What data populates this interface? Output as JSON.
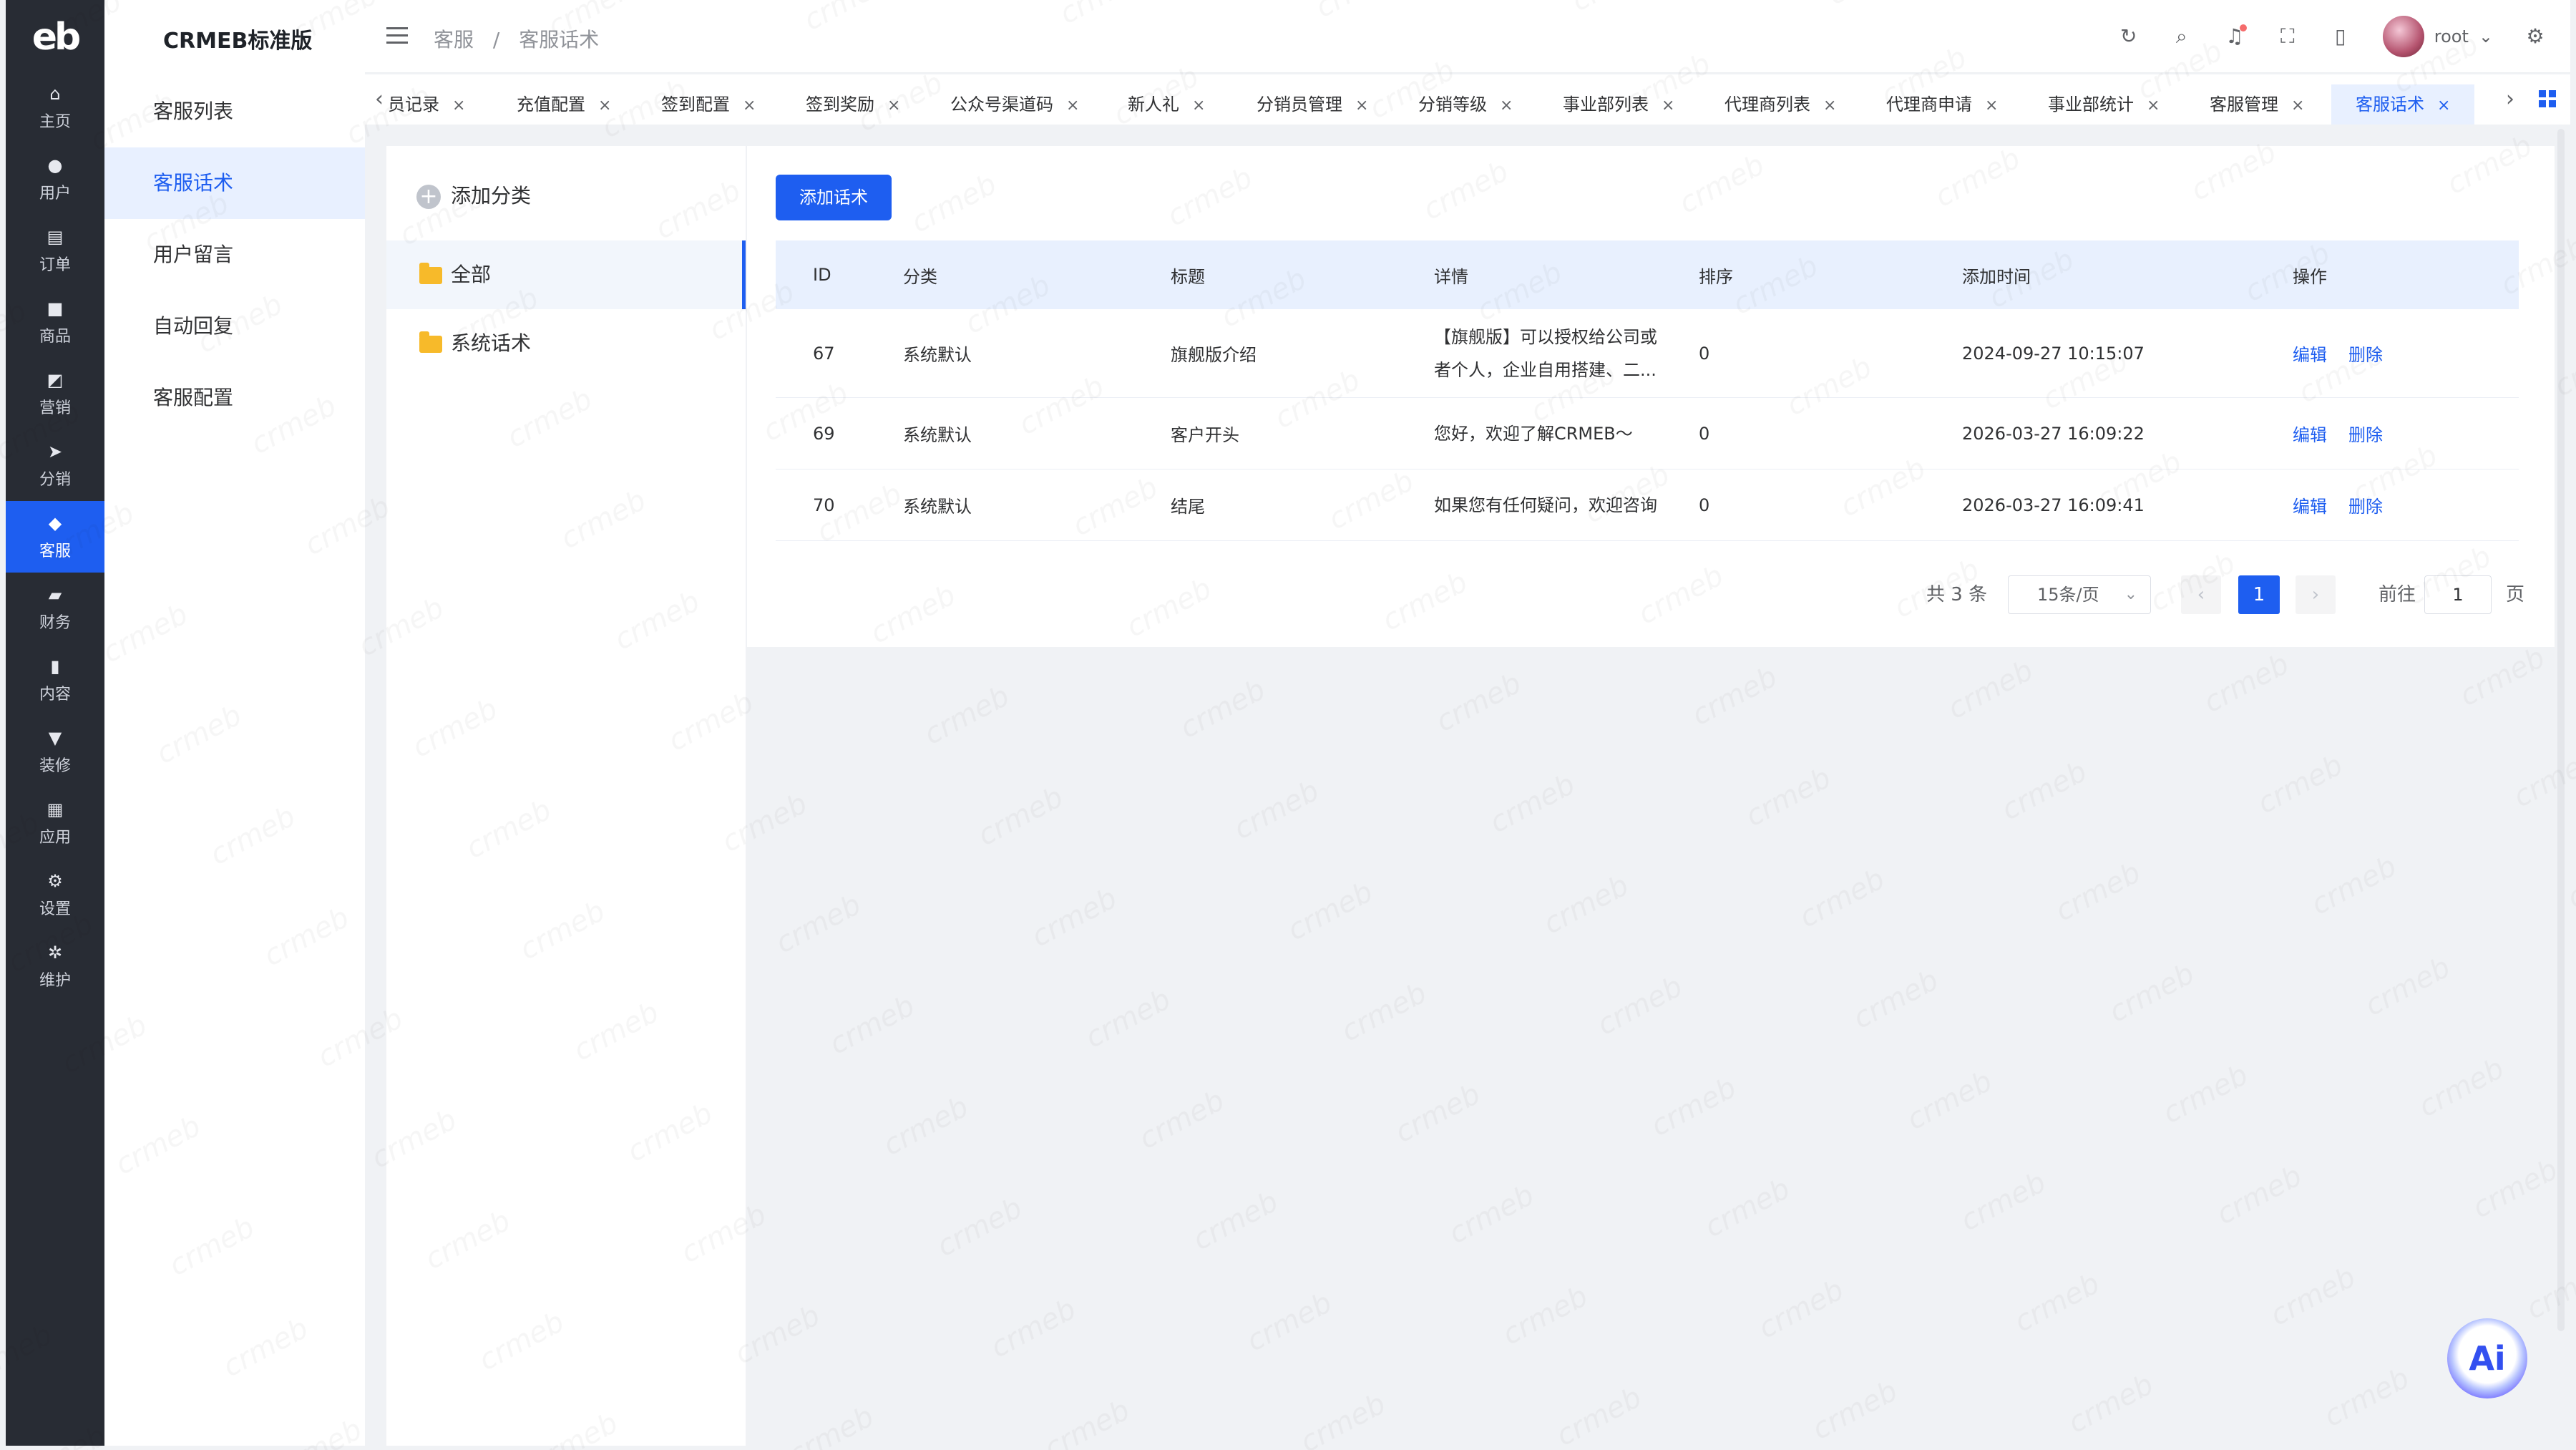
{
  "app": {
    "logo_text": "eb",
    "brand": "CRMEB标准版"
  },
  "rail": {
    "items": [
      {
        "label": "主页",
        "icon": "home-icon"
      },
      {
        "label": "用户",
        "icon": "user-icon"
      },
      {
        "label": "订单",
        "icon": "order-icon"
      },
      {
        "label": "商品",
        "icon": "product-icon"
      },
      {
        "label": "营销",
        "icon": "marketing-icon"
      },
      {
        "label": "分销",
        "icon": "send-icon"
      },
      {
        "label": "客服",
        "icon": "bell-icon"
      },
      {
        "label": "财务",
        "icon": "wallet-icon"
      },
      {
        "label": "内容",
        "icon": "content-icon"
      },
      {
        "label": "装修",
        "icon": "brush-icon"
      },
      {
        "label": "应用",
        "icon": "apps-icon"
      },
      {
        "label": "设置",
        "icon": "gear-icon"
      },
      {
        "label": "维护",
        "icon": "maintenance-icon"
      }
    ],
    "active": "客服"
  },
  "submenu": {
    "items": [
      "客服列表",
      "客服话术",
      "用户留言",
      "自动回复",
      "客服配置"
    ],
    "active": "客服话术"
  },
  "header": {
    "breadcrumb": [
      "客服",
      "/",
      "客服话术"
    ],
    "username": "root"
  },
  "tabs": {
    "items": [
      "员记录",
      "充值配置",
      "签到配置",
      "签到奖励",
      "公众号渠道码",
      "新人礼",
      "分销员管理",
      "分销等级",
      "事业部列表",
      "代理商列表",
      "代理商申请",
      "事业部统计",
      "客服管理",
      "客服话术"
    ],
    "active": "客服话术",
    "close_glyph": "×"
  },
  "categories": {
    "add_label": "添加分类",
    "items": [
      "全部",
      "系统话术"
    ],
    "active": "全部"
  },
  "main": {
    "add_button": "添加话术",
    "columns": [
      "ID",
      "分类",
      "标题",
      "详情",
      "排序",
      "添加时间",
      "操作"
    ],
    "rows": [
      {
        "id": "67",
        "category": "系统默认",
        "title": "旗舰版介绍",
        "detail_line1": "【旗舰版】可以授权给公司或",
        "detail_line2": "者个人，企业自用搭建、二...",
        "sort": "0",
        "time": "2024-09-27 10:15:07"
      },
      {
        "id": "69",
        "category": "系统默认",
        "title": "客户开头",
        "detail_line1": "您好，欢迎了解CRMEB～",
        "detail_line2": "",
        "sort": "0",
        "time": "2026-03-27 16:09:22"
      },
      {
        "id": "70",
        "category": "系统默认",
        "title": "结尾",
        "detail_line1": "如果您有任何疑问，欢迎咨询",
        "detail_line2": "",
        "sort": "0",
        "time": "2026-03-27 16:09:41"
      }
    ],
    "edit_label": "编辑",
    "delete_label": "删除"
  },
  "pagination": {
    "total": "共 3 条",
    "page_size": "15条/页",
    "current_page": "1",
    "goto_label": "前往",
    "goto_value": "1",
    "page_word": "页"
  },
  "ai_button": "Ai",
  "watermark_text": "crmeb",
  "colors": {
    "accent": "#1e5ef0",
    "rail": "#282c34",
    "header_row": "#e8f0fe"
  }
}
